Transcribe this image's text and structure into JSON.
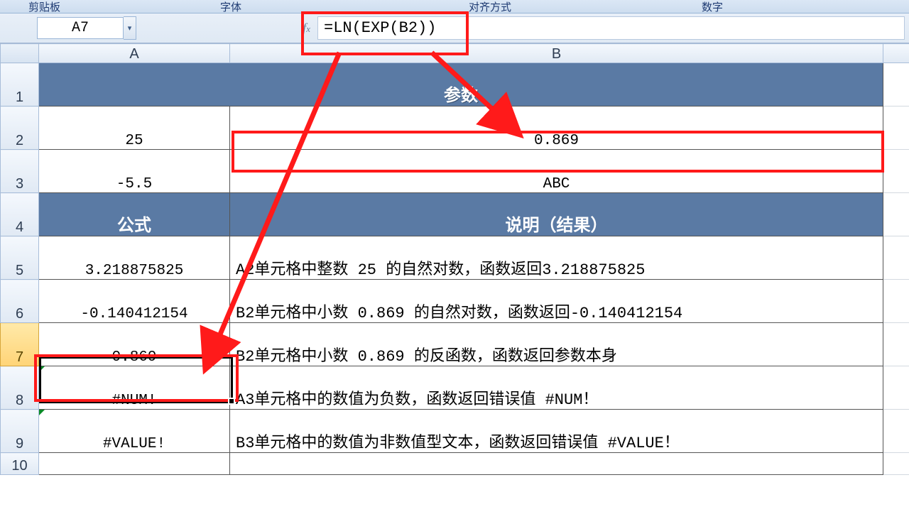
{
  "ribbon": {
    "groups": [
      "剪贴板",
      "字体",
      "对齐方式",
      "数字"
    ]
  },
  "namebox": {
    "value": "A7"
  },
  "formula": {
    "value": "=LN(EXP(B2))"
  },
  "columns": [
    "A",
    "B"
  ],
  "rows": [
    {
      "num": 1,
      "type": "header",
      "merged": "参数",
      "a": "",
      "b": ""
    },
    {
      "num": 2,
      "a": "25",
      "b": "0.869",
      "b_align": "center"
    },
    {
      "num": 3,
      "a": "-5.5",
      "b": "ABC",
      "b_align": "center"
    },
    {
      "num": 4,
      "type": "header2",
      "a": "公式",
      "b": "说明（结果）"
    },
    {
      "num": 5,
      "a": "3.218875825",
      "b": "A2单元格中整数 25 的自然对数，函数返回3.218875825"
    },
    {
      "num": 6,
      "a": "-0.140412154",
      "b": "B2单元格中小数 0.869 的自然对数，函数返回-0.140412154"
    },
    {
      "num": 7,
      "a": "0.869",
      "b": "B2单元格中小数 0.869 的反函数，函数返回参数本身",
      "selected": true
    },
    {
      "num": 8,
      "a": "#NUM!",
      "b": "A3单元格中的数值为负数，函数返回错误值 #NUM！",
      "err": true
    },
    {
      "num": 9,
      "a": "#VALUE!",
      "b": "B3单元格中的数值为非数值型文本，函数返回错误值 #VALUE！",
      "err": true
    },
    {
      "num": 10,
      "a": "",
      "b": ""
    }
  ],
  "annotations": {
    "formula_box_desc": "red box around formula bar content",
    "b2_box_desc": "red box around cell B2",
    "a7_box_desc": "red box around cell A7"
  }
}
